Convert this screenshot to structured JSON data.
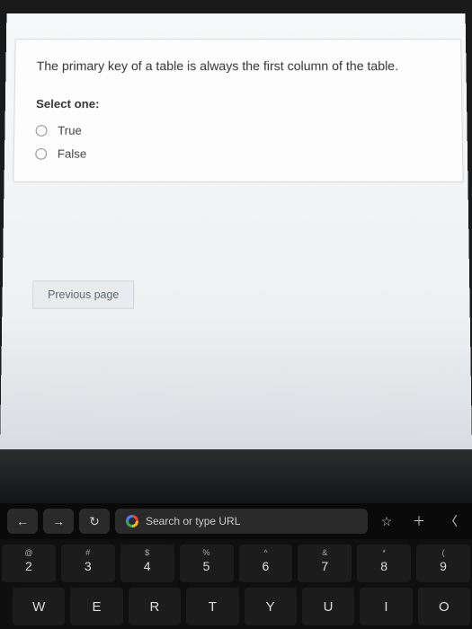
{
  "quiz": {
    "question_text": "The primary key of a table is always the first column of the table.",
    "select_label": "Select one:",
    "options": [
      "True",
      "False"
    ],
    "prev_button": "Previous page"
  },
  "touchbar": {
    "search_placeholder": "Search or type URL"
  },
  "keyboard": {
    "row1": [
      {
        "top": "@",
        "main": "2"
      },
      {
        "top": "#",
        "main": "3"
      },
      {
        "top": "$",
        "main": "4"
      },
      {
        "top": "%",
        "main": "5"
      },
      {
        "top": "^",
        "main": "6"
      },
      {
        "top": "&",
        "main": "7"
      },
      {
        "top": "*",
        "main": "8"
      },
      {
        "top": "(",
        "main": "9"
      }
    ],
    "row2": [
      "W",
      "E",
      "R",
      "T",
      "Y",
      "U",
      "I",
      "O"
    ]
  }
}
